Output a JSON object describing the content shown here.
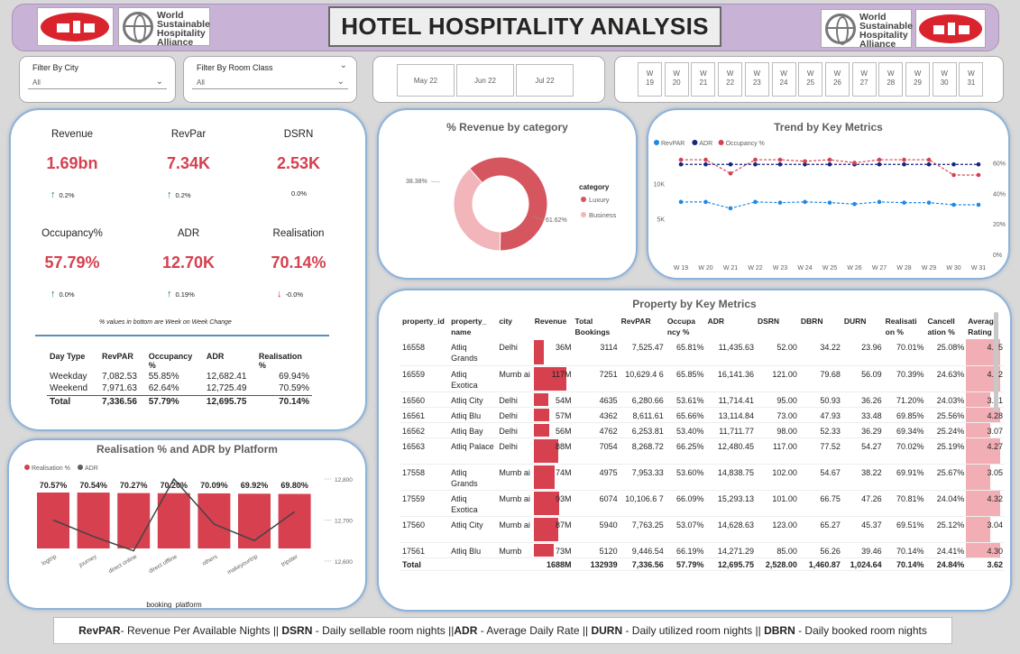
{
  "header": {
    "title": "HOTEL HOSPITALITY ANALYSIS",
    "partner_logo_text": [
      "World",
      "Sustainable",
      "Hospitality",
      "Alliance"
    ]
  },
  "filters": {
    "city": {
      "label": "Filter By City",
      "value": "All"
    },
    "room_class": {
      "label": "Filter By Room Class",
      "value": "All"
    }
  },
  "months": [
    "May 22",
    "Jun 22",
    "Jul 22"
  ],
  "weeks": [
    "W 19",
    "W 20",
    "W 21",
    "W 22",
    "W 23",
    "W 24",
    "W 25",
    "W 26",
    "W 27",
    "W 28",
    "W 29",
    "W 30",
    "W 31"
  ],
  "kpis": [
    {
      "title": "Revenue",
      "value": "1.69bn",
      "change": "0.2%",
      "dir": "up"
    },
    {
      "title": "RevPar",
      "value": "7.34K",
      "change": "0.2%",
      "dir": "up"
    },
    {
      "title": "DSRN",
      "value": "2.53K",
      "change": "0.0%",
      "dir": "none"
    },
    {
      "title": "Occupancy%",
      "value": "57.79%",
      "change": "0.0%",
      "dir": "up"
    },
    {
      "title": "ADR",
      "value": "12.70K",
      "change": "0.19%",
      "dir": "up"
    },
    {
      "title": "Realisation",
      "value": "70.14%",
      "change": "-0.0%",
      "dir": "down"
    }
  ],
  "kpi_note": "% values in bottom are Week on Week Change",
  "day_type_table": {
    "headers": [
      "Day Type",
      "RevPAR",
      "Occupancy %",
      "ADR",
      "Realisation %"
    ],
    "rows": [
      [
        "Weekday",
        "7,082.53",
        "55.85%",
        "12,682.41",
        "69.94%"
      ],
      [
        "Weekend",
        "7,971.63",
        "62.64%",
        "12,725.49",
        "70.59%"
      ]
    ],
    "total": [
      "Total",
      "7,336.56",
      "57.79%",
      "12,695.75",
      "70.14%"
    ]
  },
  "revenue_by_category": {
    "title": "% Revenue by category",
    "legend_title": "category",
    "items": [
      {
        "name": "Luxury",
        "pct": 61.62,
        "label": "61.62%",
        "color": "#d6565f"
      },
      {
        "name": "Business",
        "pct": 38.38,
        "label": "38.38%",
        "color": "#f2b5ba"
      }
    ]
  },
  "trend": {
    "title": "Trend by Key Metrics",
    "legend": [
      {
        "name": "RevPAR",
        "color": "#1e88e5"
      },
      {
        "name": "ADR",
        "color": "#1a237e"
      },
      {
        "name": "Occupancy %",
        "color": "#d6404f"
      }
    ],
    "left_ticks": [
      "10K",
      "5K"
    ],
    "right_ticks": [
      "60%",
      "40%",
      "20%",
      "0%"
    ]
  },
  "realisation_platform": {
    "title": "Realisation % and ADR by Platform",
    "legend": [
      {
        "name": "Realisation %",
        "color": "#d6404f"
      },
      {
        "name": "ADR",
        "color": "#605e5c"
      }
    ],
    "right_ticks": [
      "12,800",
      "12,700",
      "12,600"
    ],
    "xlabel": "booking_platform"
  },
  "property_table": {
    "title": "Property by Key Metrics",
    "headers": [
      "property_id",
      "property_ name",
      "city",
      "Revenue",
      "Total Bookings",
      "RevPAR",
      "Occupa ncy %",
      "ADR",
      "DSRN",
      "DBRN",
      "DURN",
      "Realisati on %",
      "Cancell ation %",
      "Average Rating"
    ],
    "rows": [
      [
        "16558",
        "Atliq Grands",
        "Delhi",
        "36M",
        "3114",
        "7,525.47",
        "65.81%",
        "11,435.63",
        "52.00",
        "34.22",
        "23.96",
        "70.01%",
        "25.08%",
        "4.25"
      ],
      [
        "16559",
        "Atliq Exotica",
        "Mumb ai",
        "117M",
        "7251",
        "10,629.4 6",
        "65.85%",
        "16,141.36",
        "121.00",
        "79.68",
        "56.09",
        "70.39%",
        "24.63%",
        "4.32"
      ],
      [
        "16560",
        "Atliq City",
        "Delhi",
        "54M",
        "4635",
        "6,280.66",
        "53.61%",
        "11,714.41",
        "95.00",
        "50.93",
        "36.26",
        "71.20%",
        "24.03%",
        "3.01"
      ],
      [
        "16561",
        "Atliq Blu",
        "Delhi",
        "57M",
        "4362",
        "8,611.61",
        "65.66%",
        "13,114.84",
        "73.00",
        "47.93",
        "33.48",
        "69.85%",
        "25.56%",
        "4.28"
      ],
      [
        "16562",
        "Atliq Bay",
        "Delhi",
        "56M",
        "4762",
        "6,253.81",
        "53.40%",
        "11,711.77",
        "98.00",
        "52.33",
        "36.29",
        "69.34%",
        "25.24%",
        "3.07"
      ],
      [
        "16563",
        "Atliq Palace",
        "Delhi",
        "88M",
        "7054",
        "8,268.72",
        "66.25%",
        "12,480.45",
        "117.00",
        "77.52",
        "54.27",
        "70.02%",
        "25.19%",
        "4.27"
      ],
      [
        "17558",
        "Atliq Grands",
        "Mumb ai",
        "74M",
        "4975",
        "7,953.33",
        "53.60%",
        "14,838.75",
        "102.00",
        "54.67",
        "38.22",
        "69.91%",
        "25.67%",
        "3.05"
      ],
      [
        "17559",
        "Atliq Exotica",
        "Mumb ai",
        "93M",
        "6074",
        "10,106.6 7",
        "66.09%",
        "15,293.13",
        "101.00",
        "66.75",
        "47.26",
        "70.81%",
        "24.04%",
        "4.32"
      ],
      [
        "17560",
        "Atliq City",
        "Mumb ai",
        "87M",
        "5940",
        "7,763.25",
        "53.07%",
        "14,628.63",
        "123.00",
        "65.27",
        "45.37",
        "69.51%",
        "25.12%",
        "3.04"
      ],
      [
        "17561",
        "Atliq Blu",
        "Mumb",
        "73M",
        "5120",
        "9,446.54",
        "66.19%",
        "14,271.29",
        "85.00",
        "56.26",
        "39.46",
        "70.14%",
        "24.41%",
        "4.30"
      ]
    ],
    "total": [
      "Total",
      "",
      "",
      "1688M",
      "132939",
      "7,336.56",
      "57.79%",
      "12,695.75",
      "2,528.00",
      "1,460.87",
      "1,024.64",
      "70.14%",
      "24.84%",
      "3.62"
    ]
  },
  "footer": {
    "parts": [
      {
        "term": "RevPAR",
        "desc": "- Revenue Per Available Nights || "
      },
      {
        "term": "DSRN",
        "desc": " - Daily sellable room nights ||"
      },
      {
        "term": "ADR",
        "desc": " - Average Daily Rate || "
      },
      {
        "term": "DURN",
        "desc": " - Daily utilized room nights || "
      },
      {
        "term": "DBRN",
        "desc": " - Daily booked room nights"
      }
    ]
  },
  "chart_data": [
    {
      "type": "pie",
      "title": "% Revenue by category",
      "categories": [
        "Luxury",
        "Business"
      ],
      "values": [
        61.62,
        38.38
      ]
    },
    {
      "type": "line",
      "title": "Trend by Key Metrics",
      "categories": [
        "W 19",
        "W 20",
        "W 21",
        "W 22",
        "W 23",
        "W 24",
        "W 25",
        "W 26",
        "W 27",
        "W 28",
        "W 29",
        "W 30",
        "W 31"
      ],
      "series": [
        {
          "name": "RevPAR",
          "axis": "left",
          "values": [
            7400,
            7400,
            6500,
            7400,
            7300,
            7400,
            7300,
            7100,
            7400,
            7300,
            7300,
            7000,
            7000
          ]
        },
        {
          "name": "ADR",
          "axis": "left",
          "values": [
            12700,
            12700,
            12700,
            12700,
            12700,
            12700,
            12700,
            12700,
            12700,
            12700,
            12700,
            12700,
            12700
          ]
        },
        {
          "name": "Occupancy %",
          "axis": "right",
          "values": [
            62,
            62,
            53,
            62,
            62,
            61,
            62,
            60,
            62,
            62,
            62,
            52,
            52
          ]
        }
      ],
      "ylim_left": [
        0,
        14000
      ],
      "ylim_right": [
        0,
        65
      ],
      "legend": "top-left"
    },
    {
      "type": "bar",
      "title": "Realisation % and ADR by Platform",
      "categories": [
        "logtrip",
        "journey",
        "direct online",
        "direct offline",
        "others",
        "makeyourtrip",
        "tripster"
      ],
      "series": [
        {
          "name": "Realisation %",
          "values": [
            70.57,
            70.54,
            70.27,
            70.2,
            70.09,
            69.92,
            69.8
          ],
          "labels": [
            "70.57%",
            "70.54%",
            "70.27%",
            "70.20%",
            "70.09%",
            "69.92%",
            "69.80%"
          ]
        },
        {
          "name": "ADR",
          "axis": "right",
          "values": [
            12700,
            12660,
            12625,
            12800,
            12690,
            12650,
            12720
          ]
        }
      ],
      "ylim_right": [
        12600,
        12800
      ],
      "xlabel": "booking_platform"
    }
  ]
}
